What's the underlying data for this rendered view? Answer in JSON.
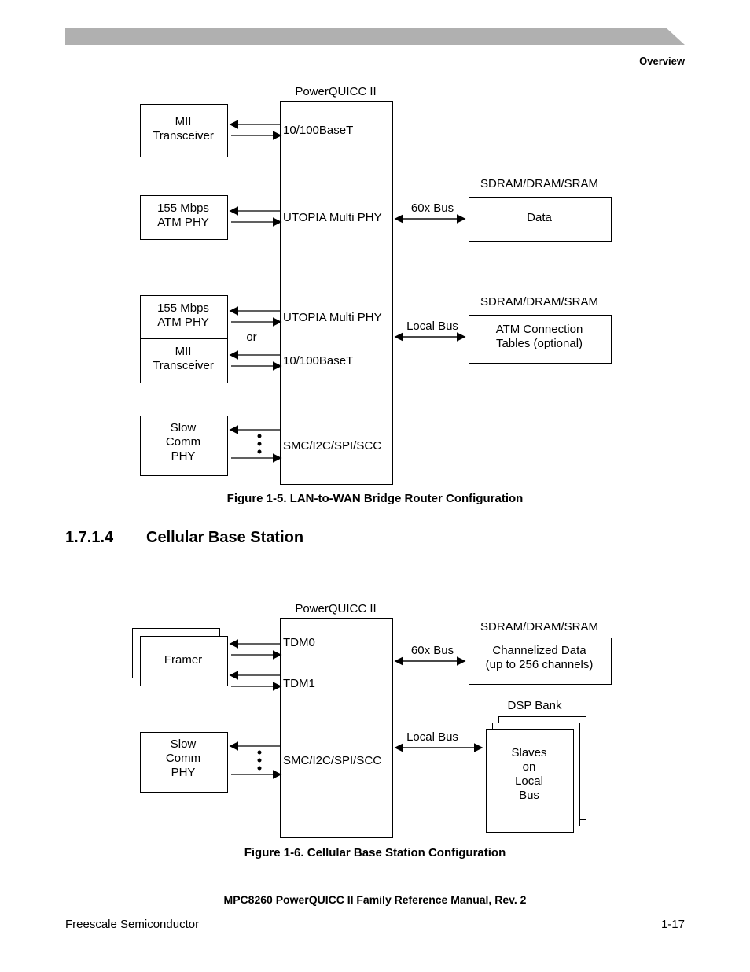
{
  "section_header": "Overview",
  "fig1": {
    "title": "PowerQUICC II",
    "left_blocks": {
      "mii1": "MII\nTransceiver",
      "atm1": "155 Mbps\nATM     PHY",
      "atm2": "155 Mbps\nATM     PHY",
      "or": "or",
      "mii2": "MII\nTransceiver",
      "slow": "Slow\nComm\nPHY"
    },
    "center_labels": {
      "l1": "10/100BaseT",
      "l2": "UTOPIA Multi PHY",
      "l3": "UTOPIA Multi PHY",
      "l4": "10/100BaseT",
      "l5": "SMC/I2C/SPI/SCC"
    },
    "bus": {
      "b60x": "60x Bus",
      "local": "Local Bus"
    },
    "right_blocks": {
      "h1": "SDRAM/DRAM/SRAM",
      "data": "Data",
      "h2": "SDRAM/DRAM/SRAM",
      "atm": "ATM Connection\nTables (optional)"
    },
    "caption": "Figure 1-5. LAN-to-WAN Bridge Router Configuration"
  },
  "section": {
    "num": "1.7.1.4",
    "title": "Cellular Base Station"
  },
  "fig2": {
    "title": "PowerQUICC II",
    "left_blocks": {
      "framer": "Framer",
      "slow": "Slow\nComm\nPHY"
    },
    "center_labels": {
      "l1": "TDM0",
      "l2": "TDM1",
      "l3": "SMC/I2C/SPI/SCC"
    },
    "bus": {
      "b60x": "60x Bus",
      "local": "Local Bus"
    },
    "right_blocks": {
      "h1": "SDRAM/DRAM/SRAM",
      "data": "Channelized Data\n(up to 256 channels)",
      "h2": "DSP Bank",
      "dsp": "Slaves\non\nLocal\nBus"
    },
    "caption": "Figure 1-6. Cellular Base Station Configuration"
  },
  "footer": {
    "title": "MPC8260 PowerQUICC II Family Reference Manual, Rev. 2",
    "left": "Freescale Semiconductor",
    "right": "1-17"
  }
}
